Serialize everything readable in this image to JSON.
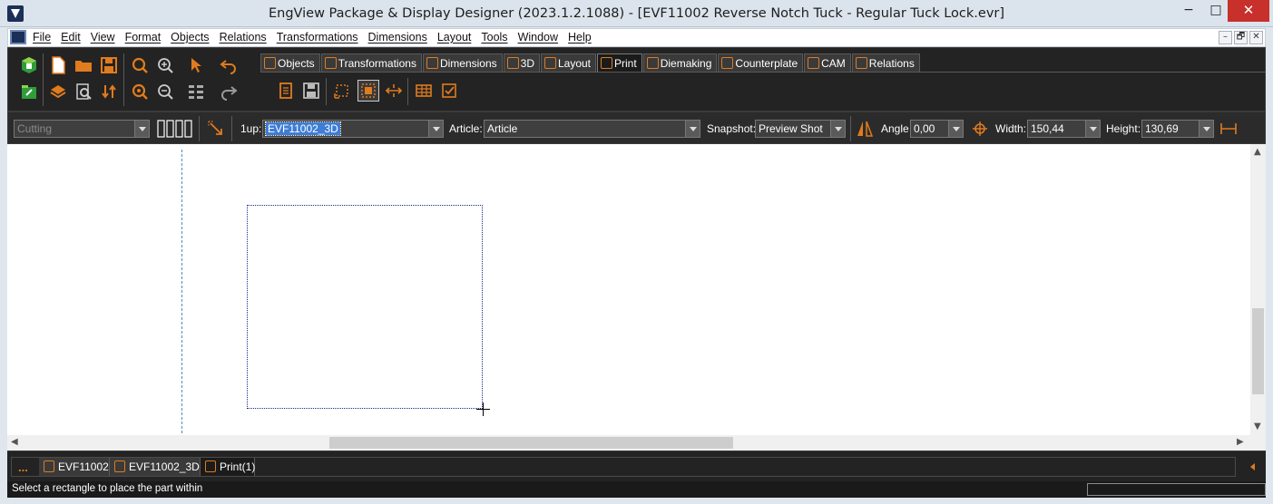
{
  "window": {
    "title": "EngView Package & Display Designer (2023.1.2.1088) - [EVF11002 Reverse Notch Tuck - Regular Tuck Lock.evr]",
    "minimize_glyph": "−",
    "maximize_glyph": "□",
    "close_glyph": "✕"
  },
  "menu": {
    "items": [
      "File",
      "Edit",
      "View",
      "Format",
      "Objects",
      "Relations",
      "Transformations",
      "Dimensions",
      "Layout",
      "Tools",
      "Window",
      "Help"
    ],
    "mdi_min": "–",
    "mdi_restore": "🗗",
    "mdi_close": "✕"
  },
  "tabs": [
    {
      "label": "Objects"
    },
    {
      "label": "Transformations"
    },
    {
      "label": "Dimensions"
    },
    {
      "label": "3D"
    },
    {
      "label": "Layout"
    },
    {
      "label": "Print"
    },
    {
      "label": "Diemaking"
    },
    {
      "label": "Counterplate"
    },
    {
      "label": "CAM"
    },
    {
      "label": "Relations"
    }
  ],
  "active_tab": "Print",
  "propbar": {
    "mode_value": "Cutting",
    "oneup_label": "1up:",
    "oneup_value": "EVF11002_3D",
    "article_label": "Article:",
    "article_value": "Article",
    "snapshot_label": "Snapshot:",
    "snapshot_value": "Preview Shot",
    "angle_label": "Angle",
    "angle_value": "0,00",
    "width_label": "Width:",
    "width_value": "150,44",
    "height_label": "Height:",
    "height_value": "130,69"
  },
  "doc_tabs": {
    "more": "...",
    "items": [
      "EVF11002",
      "EVF11002_3D",
      "Print(1)"
    ],
    "active": "Print(1)"
  },
  "status": {
    "message": "Select a rectangle to place the part within"
  },
  "colors": {
    "accent": "#e07b1e",
    "toolbar_bg": "#232323",
    "selection": "#3d7dd6"
  }
}
